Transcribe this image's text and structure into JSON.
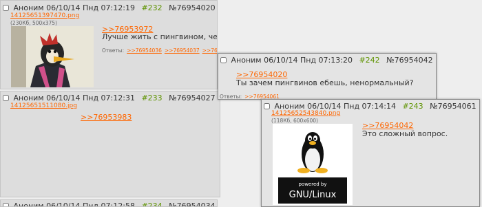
{
  "posts": [
    {
      "author": "Аноним",
      "date": "06/10/14 Пнд 07:12:19",
      "num": "#232",
      "id": "№76954020",
      "file_name": "14125651397470.png",
      "file_meta": "(230Кб, 500x375)",
      "ref": ">>76953972",
      "text": "Лучше жить с пингвином, чем с бревном или истеричкой.",
      "replies_label": "Ответы:",
      "replies": [
        ">>76954036",
        ">>76954037",
        ">>76954042"
      ]
    },
    {
      "author": "Аноним",
      "date": "06/10/14 Пнд 07:12:31",
      "num": "#233",
      "id": "№76954027",
      "file_name": "14125651511080.jpg",
      "ref": ">>76953983"
    },
    {
      "author": "Аноним",
      "date": "06/10/14 Пнд 07:12:58",
      "num": "#234",
      "id": "№76954034"
    }
  ],
  "popups": [
    {
      "author": "Аноним",
      "date": "06/10/14 Пнд 07:13:20",
      "num": "#242",
      "id": "№76954042",
      "ref": ">>76954020",
      "text": "Ты зачем пингвинов ебешь, ненормальный?",
      "replies_label": "Ответы:",
      "replies": [
        ">>76954061"
      ]
    },
    {
      "author": "Аноним",
      "date": "06/10/14 Пнд 07:14:14",
      "num": "#243",
      "id": "№76954061",
      "file_name": "14125652543840.png",
      "file_meta": "(118Кб, 600x600)",
      "ref": ">>76954042",
      "text": "Это сложный вопрос.",
      "image_caption_top": "powered by",
      "image_caption_bottom": "GNU/Linux"
    }
  ],
  "colors": {
    "accent": "#ff6600",
    "post_num": "#5e9300",
    "post_bg": "#dddddd",
    "page_bg": "#eeeeee"
  }
}
